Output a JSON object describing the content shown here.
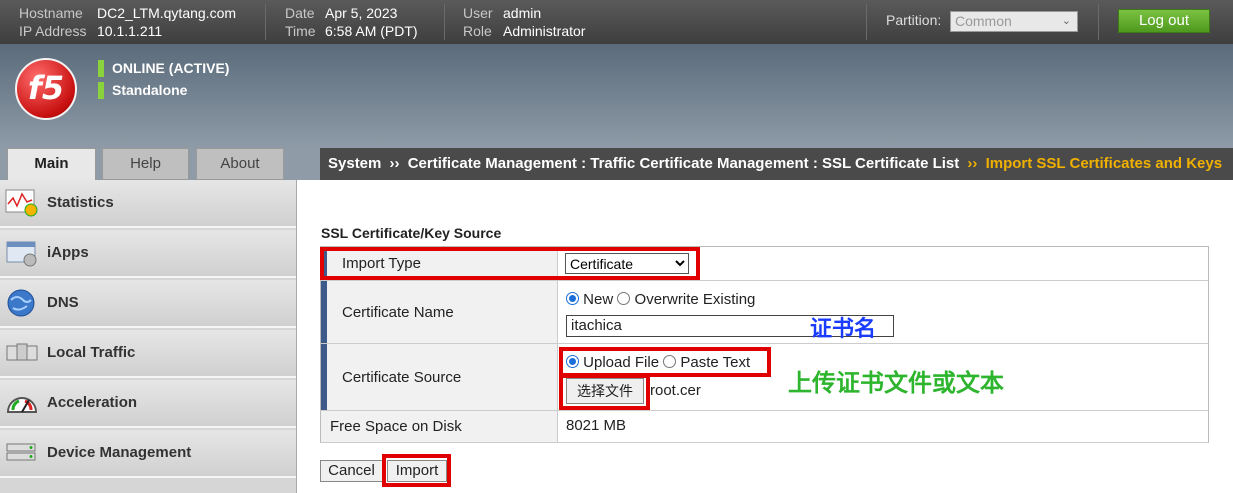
{
  "topbar": {
    "hostname_label": "Hostname",
    "hostname": "DC2_LTM.qytang.com",
    "ip_label": "IP Address",
    "ip": "10.1.1.211",
    "date_label": "Date",
    "date": "Apr 5, 2023",
    "time_label": "Time",
    "time": "6:58 AM (PDT)",
    "user_label": "User",
    "user": "admin",
    "role_label": "Role",
    "role": "Administrator",
    "partition_label": "Partition:",
    "partition_value": "Common",
    "logout_label": "Log out"
  },
  "header": {
    "logo_text": "f5",
    "status_online": "ONLINE (ACTIVE)",
    "status_mode": "Standalone"
  },
  "tabs": [
    {
      "label": "Main",
      "active": true
    },
    {
      "label": "Help",
      "active": false
    },
    {
      "label": "About",
      "active": false
    }
  ],
  "breadcrumb": {
    "items": [
      "System",
      "Certificate Management : Traffic Certificate Management : SSL Certificate List"
    ],
    "separator": "››",
    "current": "Import SSL Certificates and Keys"
  },
  "sidebar": {
    "items": [
      {
        "label": "Statistics",
        "icon": "statistics-icon"
      },
      {
        "label": "iApps",
        "icon": "iapps-icon"
      },
      {
        "label": "DNS",
        "icon": "dns-globe-icon"
      },
      {
        "label": "Local Traffic",
        "icon": "local-traffic-icon"
      },
      {
        "label": "Acceleration",
        "icon": "acceleration-gauge-icon"
      },
      {
        "label": "Device Management",
        "icon": "device-management-icon"
      }
    ]
  },
  "form": {
    "section_title": "SSL Certificate/Key Source",
    "import_type_label": "Import Type",
    "import_type_value": "Certificate",
    "cert_name_label": "Certificate Name",
    "cert_name_option_new": "New",
    "cert_name_option_overwrite": "Overwrite Existing",
    "cert_name_value": "itachica",
    "cert_source_label": "Certificate Source",
    "cert_source_option_upload": "Upload File",
    "cert_source_option_paste": "Paste Text",
    "choose_file_label": "选择文件",
    "file_name": "root.cer",
    "free_space_label": "Free Space on Disk",
    "free_space_value": "8021 MB",
    "cancel_label": "Cancel",
    "import_label": "Import"
  },
  "annotations": {
    "cert_name_note": "证书名",
    "cert_source_note": "上传证书文件或文本",
    "cert_name_note_color": "#1a3cff",
    "cert_source_note_color": "#2db52d",
    "highlight_color": "#e00000"
  }
}
